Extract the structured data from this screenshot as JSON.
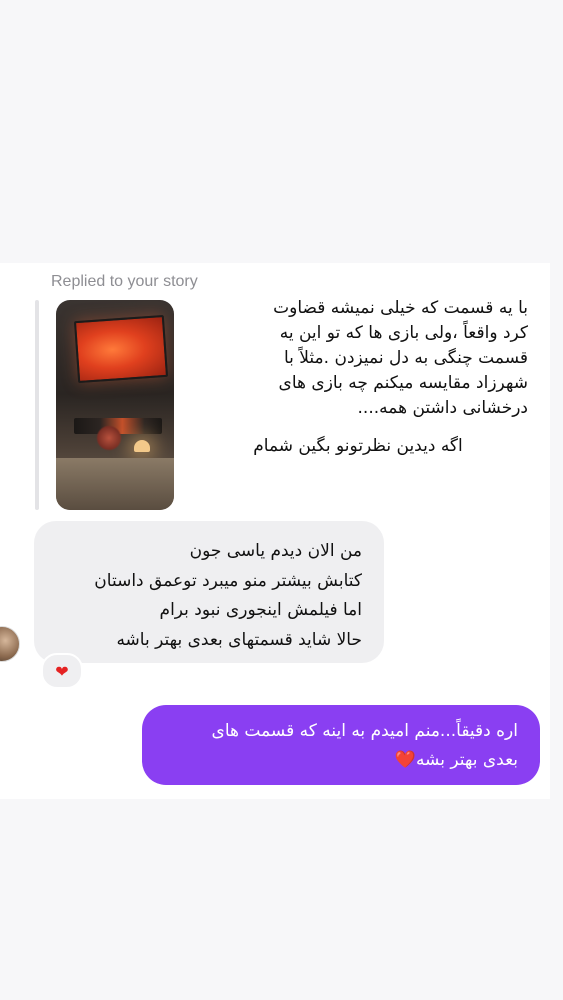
{
  "thread": {
    "replied_label": "Replied to your story",
    "story_reply": {
      "lines": [
        "با یه قسمت که خیلی نمیشه قضاوت",
        "کرد واقعاً ،ولی بازی ها که تو این یه",
        "قسمت چنگی به دل نمیزدن .مثلاً با",
        "شهرزاد مقایسه میکنم چه بازی های",
        "درخشانی داشتن همه...."
      ],
      "footer": "اگه دیدین نظرتونو بگین شمام"
    },
    "incoming": {
      "lines": [
        "من الان دیدم یاسی جون",
        "کتابش بیشتر منو میبرد توعمق داستان",
        "اما فیلمش اینجوری نبود برام",
        "حالا شاید قسمتهای بعدی بهتر باشه"
      ],
      "reaction": "❤"
    },
    "outgoing": {
      "line1": "اره دقیقاً...منم امیدم به اینه که قسمت های",
      "line2": "بعدی بهتر بشه",
      "heart": "❤️"
    }
  },
  "colors": {
    "outgoing_bubble": "#8a3ff2",
    "incoming_bubble": "#efeff1",
    "heart": "#e52222"
  },
  "icons": {
    "reaction": "heart-icon",
    "avatar": "user-avatar"
  }
}
